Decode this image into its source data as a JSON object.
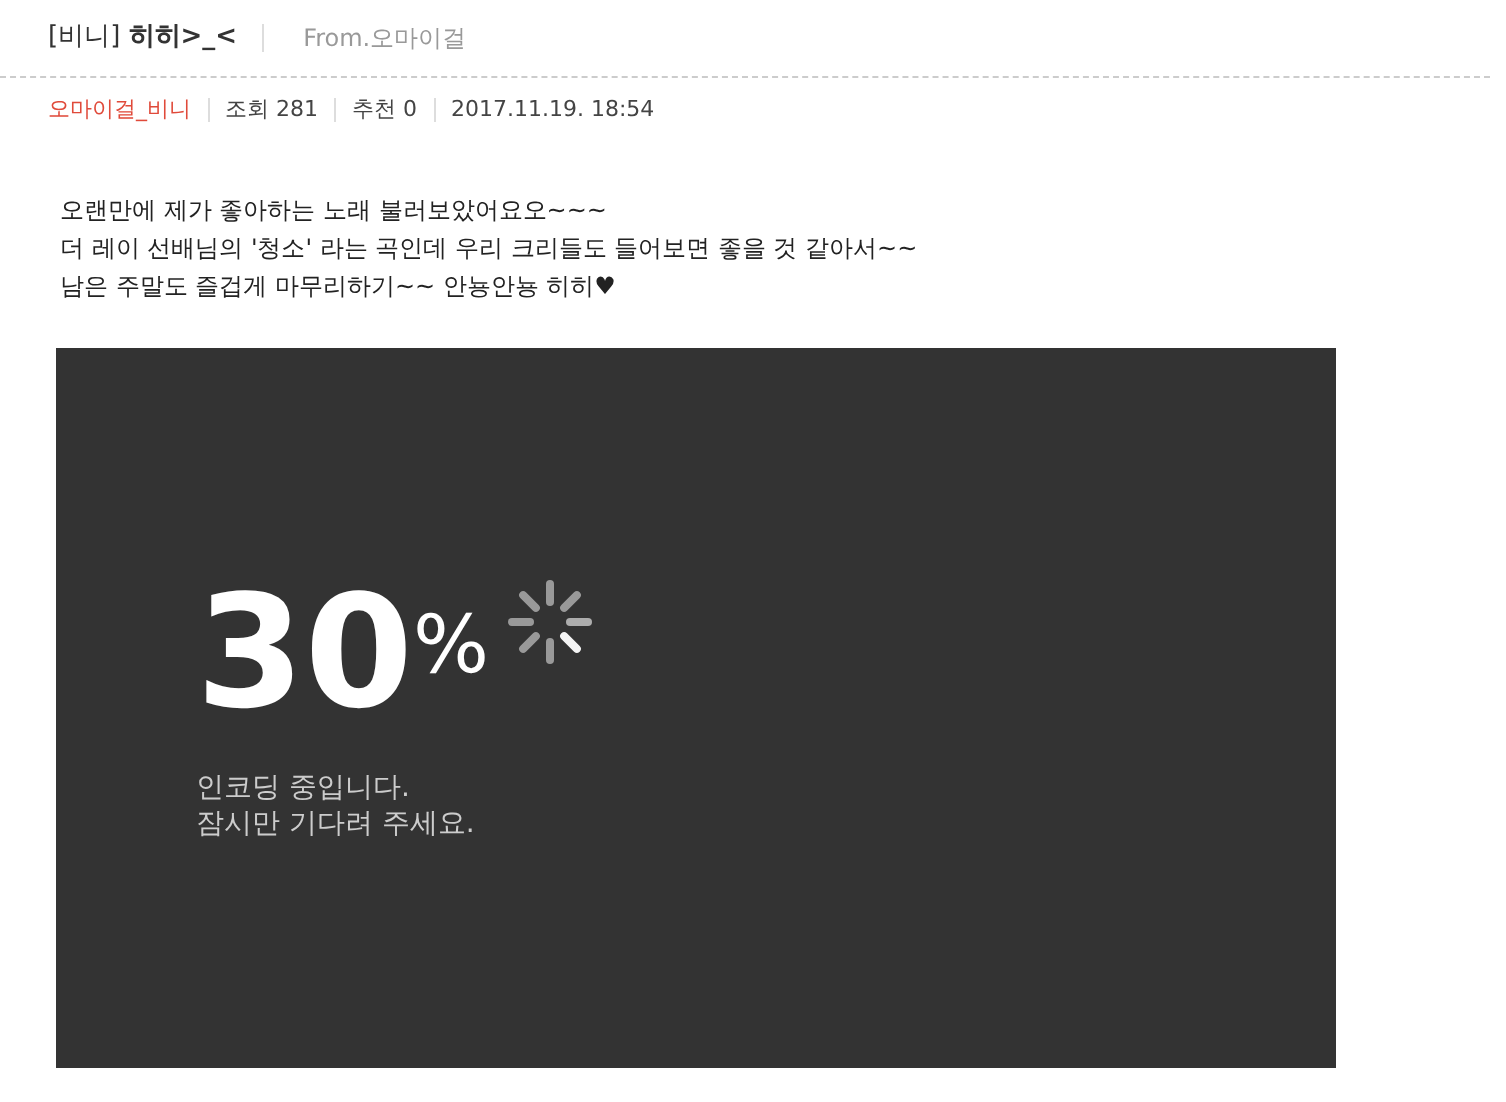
{
  "post": {
    "title": "[비니] **히히>_<**",
    "from": "From.오마이걸"
  },
  "meta": {
    "author": "오마이걸_비니",
    "views": "조회 281",
    "recommends": "추천 0",
    "date": "2017.11.19. 18:54"
  },
  "body": [
    "오랜만에 제가 좋아하는 노래 불러보았어요오~~~",
    "더 레이 선배님의 '청소' 라는 곡인데 우리 크리들도 들어보면 좋을 것 같아서~~",
    "남은 주말도 즐겁게 마무리하기~~ 안뇽안뇽 히히♥"
  ],
  "video": {
    "progress": "30",
    "unit": "%",
    "messages": [
      "인코딩 중입니다.",
      "잠시만 기다려 주세요."
    ]
  }
}
